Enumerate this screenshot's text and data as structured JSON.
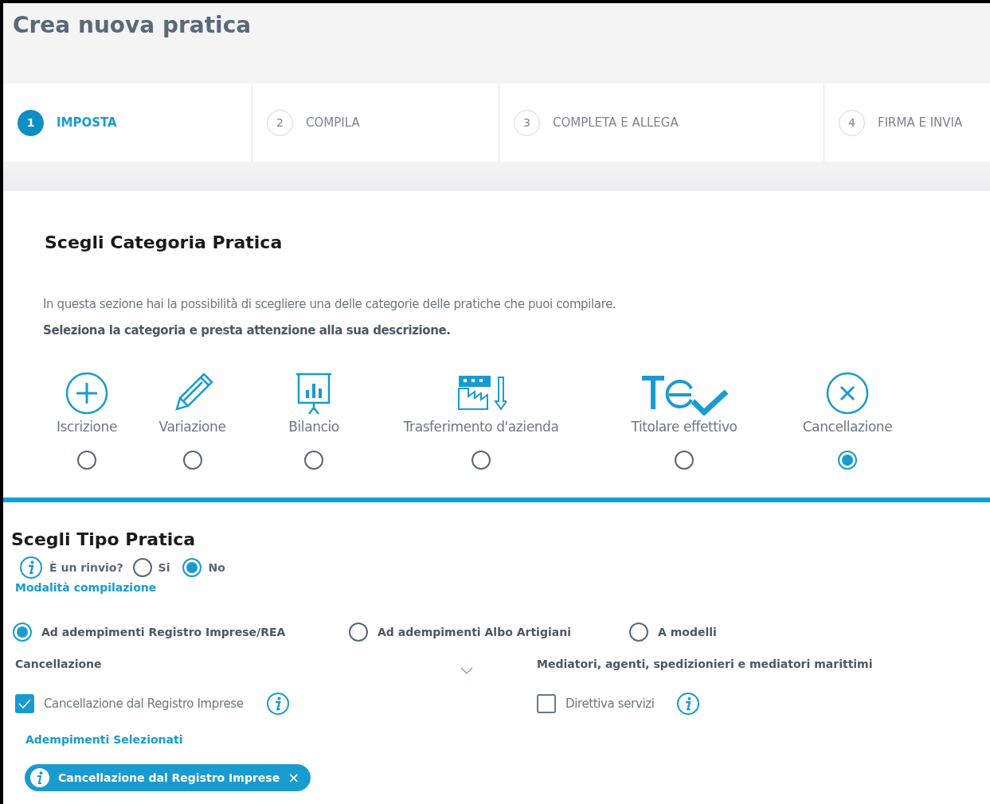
{
  "page_title": "Crea nuova pratica",
  "steps": [
    {
      "number": "1",
      "label": "IMPOSTA",
      "selected": true
    },
    {
      "number": "2",
      "label": "COMPILA",
      "selected": false
    },
    {
      "number": "3",
      "label": "COMPLETA E ALLEGA",
      "selected": false
    },
    {
      "number": "4",
      "label": "FIRMA E INVIA",
      "selected": false
    }
  ],
  "category_section": {
    "title": "Scegli Categoria Pratica",
    "intro": "In questa sezione hai la possibilità di scegliere una delle categorie delle pratiche che puoi compilare.",
    "instruction": "Seleziona la categoria e presta attenzione alla sua descrizione.",
    "categories": [
      {
        "kind": "plus",
        "label": "Iscrizione",
        "selected": false
      },
      {
        "kind": "pencil",
        "label": "Variazione",
        "selected": false
      },
      {
        "kind": "chart",
        "label": "Bilancio",
        "selected": false
      },
      {
        "kind": "factory",
        "label": "Trasferimento d'azienda",
        "selected": false
      },
      {
        "kind": "owner",
        "label": "Titolare effettivo",
        "selected": false
      },
      {
        "kind": "cross",
        "label": "Cancellazione",
        "selected": true
      }
    ]
  },
  "type_section": {
    "title": "Scegli Tipo Pratica",
    "rinvio_label": "È un rinvio?",
    "rinvio_options": [
      {
        "label": "Si",
        "selected": false
      },
      {
        "label": "No",
        "selected": true
      }
    ],
    "mode_label": "Modalità compilazione",
    "modes": [
      {
        "label": "Ad adempimenti Registro Imprese/REA",
        "selected": true
      },
      {
        "label": "Ad adempimenti Albo Artigiani",
        "selected": false
      },
      {
        "label": "A modelli",
        "selected": false
      }
    ],
    "groups": [
      {
        "label": "Cancellazione",
        "dropdown": true,
        "items": [
          {
            "label": "Cancellazione dal Registro Imprese",
            "checked": true
          }
        ]
      },
      {
        "label": "Mediatori, agenti, spedizionieri e mediatori marittimi",
        "dropdown": false,
        "items": [
          {
            "label": "Direttiva servizi",
            "checked": false
          }
        ]
      }
    ],
    "selected_title": "Adempimenti Selezionati",
    "selected_chips": [
      {
        "label": "Cancellazione dal Registro Imprese",
        "close": "×"
      }
    ]
  }
}
